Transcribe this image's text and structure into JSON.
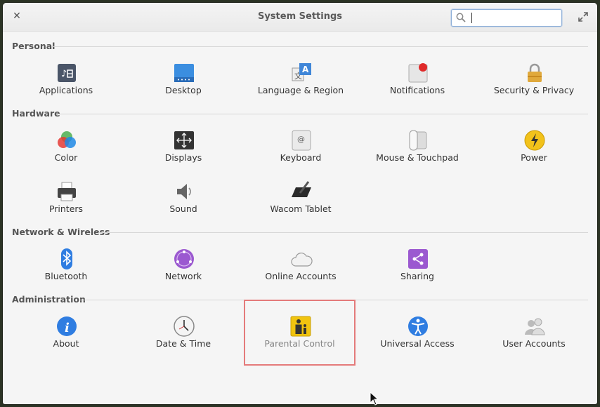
{
  "window": {
    "title": "System Settings"
  },
  "search": {
    "value": "",
    "placeholder": ""
  },
  "sections": [
    {
      "name": "Personal",
      "items": [
        "Applications",
        "Desktop",
        "Language & Region",
        "Notifications",
        "Security & Privacy"
      ]
    },
    {
      "name": "Hardware",
      "items": [
        "Color",
        "Displays",
        "Keyboard",
        "Mouse & Touchpad",
        "Power",
        "Printers",
        "Sound",
        "Wacom Tablet"
      ]
    },
    {
      "name": "Network & Wireless",
      "items": [
        "Bluetooth",
        "Network",
        "Online Accounts",
        "Sharing"
      ]
    },
    {
      "name": "Administration",
      "items": [
        "About",
        "Date & Time",
        "Parental Control",
        "Universal Access",
        "User Accounts"
      ]
    }
  ],
  "icons": {
    "close": "close-icon",
    "maximize": "maximize-icon",
    "search": "search-icon"
  },
  "colors": {
    "highlight": "#e47a7a",
    "search_focus": "#8fb0d8"
  }
}
